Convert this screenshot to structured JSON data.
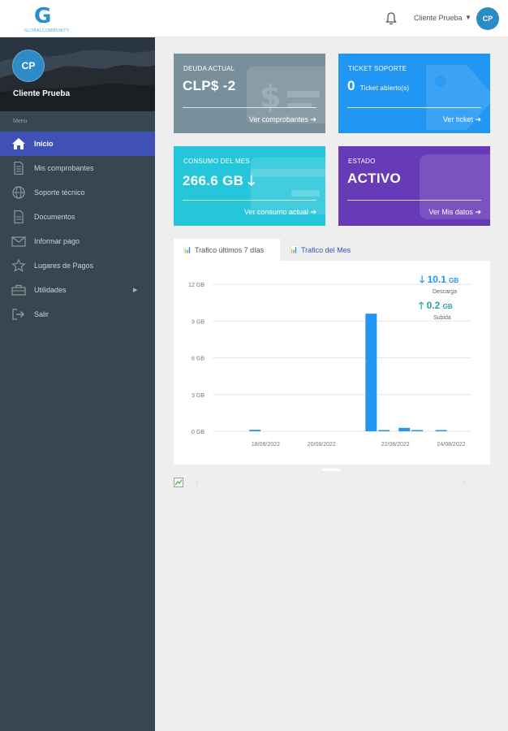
{
  "header": {
    "logo_letter": "G",
    "logo_text": "GLOBALCOMMUNITY",
    "user_name": "Cliente Prueba",
    "user_initials": "CP"
  },
  "sidebar": {
    "initials": "CP",
    "name": "Cliente Prueba",
    "menu_header": "Menu",
    "items": [
      {
        "label": "Inicio",
        "icon": "home-icon"
      },
      {
        "label": "Mis comprobantes",
        "icon": "document-icon"
      },
      {
        "label": "Soporte técnico",
        "icon": "globe-icon"
      },
      {
        "label": "Documentos",
        "icon": "file-icon"
      },
      {
        "label": "Informar pago",
        "icon": "envelope-icon"
      },
      {
        "label": "Lugares de Pagos",
        "icon": "star-icon"
      },
      {
        "label": "Utilidades",
        "icon": "toolbox-icon"
      },
      {
        "label": "Salir",
        "icon": "sign-out-icon"
      }
    ]
  },
  "cards": {
    "deuda": {
      "label": "DEUDA ACTUAL",
      "value": "CLP$ -2",
      "link": "Ver comprobantes",
      "color": "#78909c"
    },
    "ticket": {
      "label": "TICKET SOPORTE",
      "value": "0",
      "sub": "Ticket abierto(s)",
      "link": "Ver ticket",
      "color": "#2196f3"
    },
    "consumo": {
      "label": "CONSUMO DEL MES",
      "value": "266.6 GB",
      "link": "Ver consumo actual",
      "color": "#26c6da"
    },
    "estado": {
      "label": "ESTADO",
      "value": "ACTIVO",
      "link": "Ver Mis datos",
      "color": "#673ab7"
    }
  },
  "tabs": {
    "week": "Trafico últimos 7 días",
    "month": "Trafico del Mes"
  },
  "stats": {
    "download_value": "10.1",
    "download_unit": "GB",
    "download_caption": "Descarga",
    "upload_value": "0.2",
    "upload_unit": "GB",
    "upload_caption": "Subida"
  },
  "chart_data": {
    "type": "bar",
    "ylim": [
      0,
      12
    ],
    "yticks": [
      0,
      3,
      6,
      9,
      12
    ],
    "ytick_labels": [
      "0 GB",
      "3 GB",
      "6 GB",
      "9 GB",
      "12 GB"
    ],
    "xtick_labels": [
      "18/08/2022",
      "20/08/2022",
      "22/08/2022",
      "24/08/2022"
    ],
    "grid": true,
    "color": "#2196f3",
    "bars": [
      {
        "x": 1.15,
        "value": 0.12
      },
      {
        "x": 4.3,
        "value": 9.6
      },
      {
        "x": 4.65,
        "value": 0.1
      },
      {
        "x": 5.2,
        "value": 0.28
      },
      {
        "x": 5.55,
        "value": 0.1
      },
      {
        "x": 6.2,
        "value": 0.1
      }
    ]
  }
}
